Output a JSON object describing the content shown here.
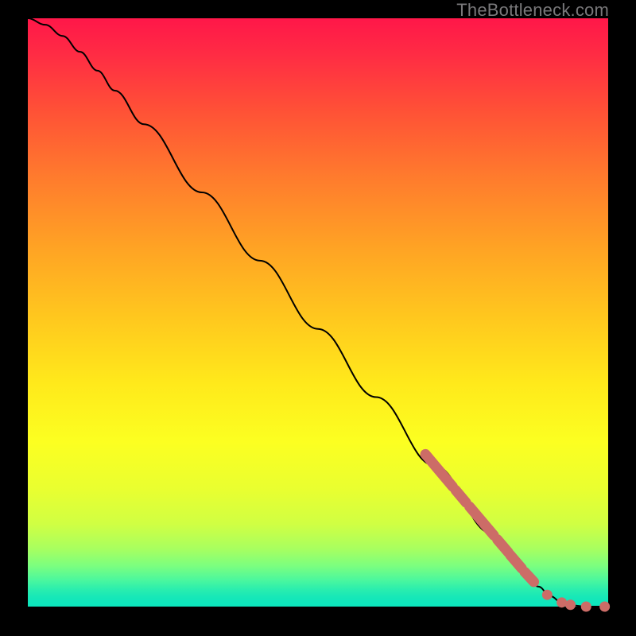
{
  "attribution": "TheBottleneck.com",
  "chart_data": {
    "type": "line",
    "title": "",
    "xlabel": "",
    "ylabel": "",
    "xlim": [
      0,
      100
    ],
    "ylim": [
      0,
      100
    ],
    "grid": false,
    "curve": [
      {
        "x": 0.0,
        "y": 100.0
      },
      {
        "x": 3.0,
        "y": 98.9
      },
      {
        "x": 6.0,
        "y": 97.0
      },
      {
        "x": 9.0,
        "y": 94.3
      },
      {
        "x": 12.0,
        "y": 91.1
      },
      {
        "x": 15.0,
        "y": 87.7
      },
      {
        "x": 20.0,
        "y": 82.0
      },
      {
        "x": 30.0,
        "y": 70.4
      },
      {
        "x": 40.0,
        "y": 58.8
      },
      {
        "x": 50.0,
        "y": 47.2
      },
      {
        "x": 60.0,
        "y": 35.6
      },
      {
        "x": 70.0,
        "y": 24.0
      },
      {
        "x": 80.0,
        "y": 12.4
      },
      {
        "x": 85.0,
        "y": 6.6
      },
      {
        "x": 88.0,
        "y": 3.4
      },
      {
        "x": 90.0,
        "y": 1.8
      },
      {
        "x": 92.0,
        "y": 0.7
      },
      {
        "x": 94.0,
        "y": 0.2
      },
      {
        "x": 96.0,
        "y": 0.0
      },
      {
        "x": 98.0,
        "y": 0.0
      },
      {
        "x": 100.0,
        "y": 0.0
      }
    ],
    "highlight_segments": [
      {
        "x0": 68.5,
        "y0": 25.9,
        "x1": 73.2,
        "y1": 20.4
      },
      {
        "x0": 73.7,
        "y0": 19.8,
        "x1": 75.5,
        "y1": 17.7
      },
      {
        "x0": 76.1,
        "y0": 17.0,
        "x1": 80.3,
        "y1": 12.1
      },
      {
        "x0": 80.9,
        "y0": 11.4,
        "x1": 82.8,
        "y1": 9.2
      },
      {
        "x0": 83.1,
        "y0": 8.8,
        "x1": 85.1,
        "y1": 6.5
      },
      {
        "x0": 85.6,
        "y0": 5.9,
        "x1": 87.2,
        "y1": 4.2
      }
    ],
    "highlight_dots": [
      {
        "x": 89.5,
        "y": 2.0
      },
      {
        "x": 92.0,
        "y": 0.7
      },
      {
        "x": 93.5,
        "y": 0.3
      },
      {
        "x": 96.2,
        "y": 0.0
      },
      {
        "x": 99.4,
        "y": 0.0
      }
    ],
    "marker_color": "#cc6c67",
    "line_color": "#000000"
  }
}
